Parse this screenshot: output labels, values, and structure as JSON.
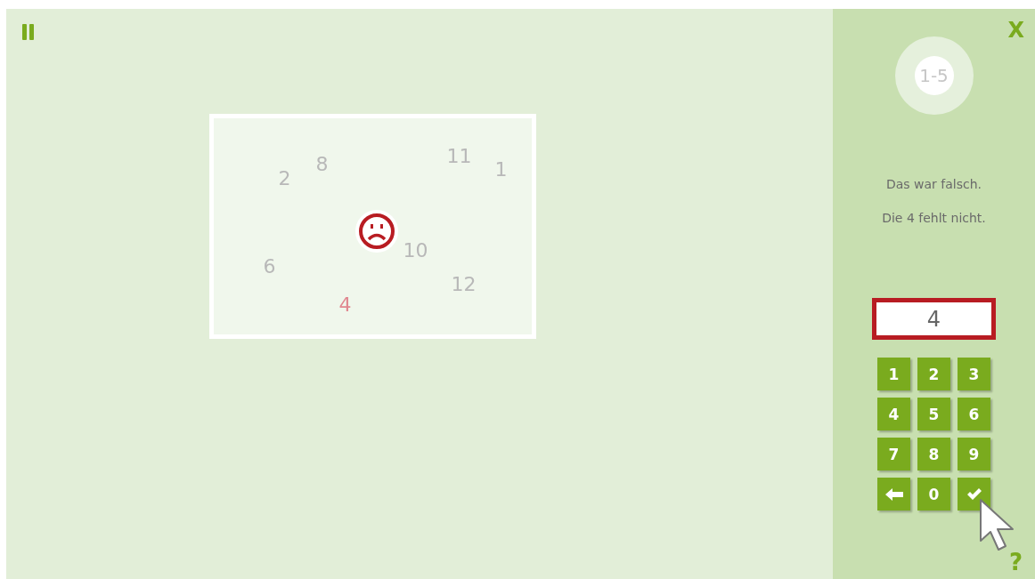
{
  "toolbar": {
    "close": "X"
  },
  "progress": {
    "label": "1-5"
  },
  "feedback": [
    "Das war falsch.",
    "Die 4 fehlt nicht."
  ],
  "card": {
    "correct": false,
    "numbers": [
      {
        "text": "2",
        "marked": false
      },
      {
        "text": "8",
        "marked": false
      },
      {
        "text": "11",
        "marked": false
      },
      {
        "text": "1",
        "marked": false
      },
      {
        "text": "10",
        "marked": false
      },
      {
        "text": "6",
        "marked": false
      },
      {
        "text": "12",
        "marked": false
      },
      {
        "text": "4",
        "marked": true
      }
    ]
  },
  "answer": {
    "value": "4",
    "wrong": true
  },
  "keypad": [
    {
      "kind": "digit",
      "label": "1"
    },
    {
      "kind": "digit",
      "label": "2"
    },
    {
      "kind": "digit",
      "label": "3"
    },
    {
      "kind": "digit",
      "label": "4"
    },
    {
      "kind": "digit",
      "label": "5"
    },
    {
      "kind": "digit",
      "label": "6"
    },
    {
      "kind": "digit",
      "label": "7"
    },
    {
      "kind": "digit",
      "label": "8"
    },
    {
      "kind": "digit",
      "label": "9"
    },
    {
      "kind": "backspace"
    },
    {
      "kind": "digit",
      "label": "0"
    },
    {
      "kind": "confirm"
    }
  ],
  "help": "?"
}
